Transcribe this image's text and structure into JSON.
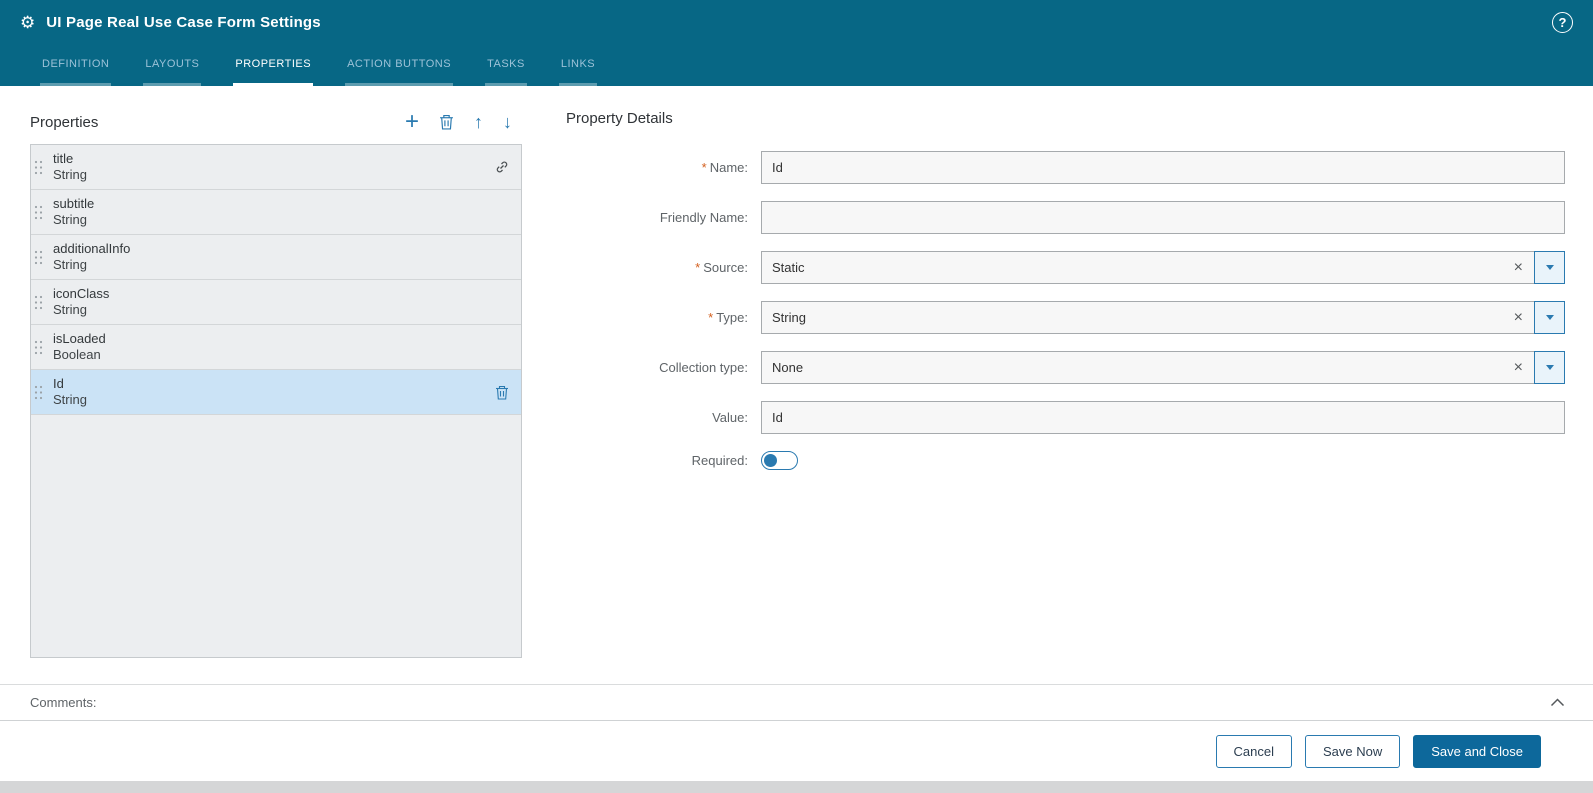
{
  "required_marker": "*",
  "icons": {
    "add": "+",
    "move_up": "↑",
    "move_down": "↓",
    "clear": "×",
    "help": "?",
    "gear": "⚙"
  },
  "colors": {
    "header_bg": "#076785",
    "accent": "#2a7ab0",
    "selected_row": "#cbe3f6",
    "required": "#d35f1e",
    "list_bg": "#eceef0",
    "list_border": "#c6cacd",
    "input_bg": "#f7f7f7",
    "input_border": "#a6aaad",
    "primary_btn": "#0d689b",
    "text": "#333333",
    "label": "#5f6468"
  },
  "header": {
    "title": "UI Page Real Use Case Form Settings",
    "tabs": [
      {
        "label": "DEFINITION",
        "active": false
      },
      {
        "label": "LAYOUTS",
        "active": false
      },
      {
        "label": "PROPERTIES",
        "active": true
      },
      {
        "label": "ACTION BUTTONS",
        "active": false
      },
      {
        "label": "TASKS",
        "active": false
      },
      {
        "label": "LINKS",
        "active": false
      }
    ]
  },
  "properties_panel": {
    "title": "Properties",
    "items": [
      {
        "name": "title",
        "type": "String",
        "selected": false,
        "linked": true
      },
      {
        "name": "subtitle",
        "type": "String",
        "selected": false
      },
      {
        "name": "additionalInfo",
        "type": "String",
        "selected": false
      },
      {
        "name": "iconClass",
        "type": "String",
        "selected": false
      },
      {
        "name": "isLoaded",
        "type": "Boolean",
        "selected": false
      },
      {
        "name": "Id",
        "type": "String",
        "selected": true
      }
    ]
  },
  "details": {
    "title": "Property Details",
    "name": {
      "label": "Name:",
      "required": true,
      "value": "Id"
    },
    "friendly_name": {
      "label": "Friendly Name:",
      "required": false,
      "value": ""
    },
    "source": {
      "label": "Source:",
      "required": true,
      "value": "Static"
    },
    "type": {
      "label": "Type:",
      "required": true,
      "value": "String"
    },
    "collection_type": {
      "label": "Collection type:",
      "required": false,
      "value": "None"
    },
    "value": {
      "label": "Value:",
      "required": false,
      "value": "Id"
    },
    "required_toggle": {
      "label": "Required:",
      "state": "off"
    }
  },
  "comments": {
    "label": "Comments:"
  },
  "footer": {
    "cancel_label": "Cancel",
    "save_now_label": "Save Now",
    "save_and_close_label": "Save and Close"
  }
}
